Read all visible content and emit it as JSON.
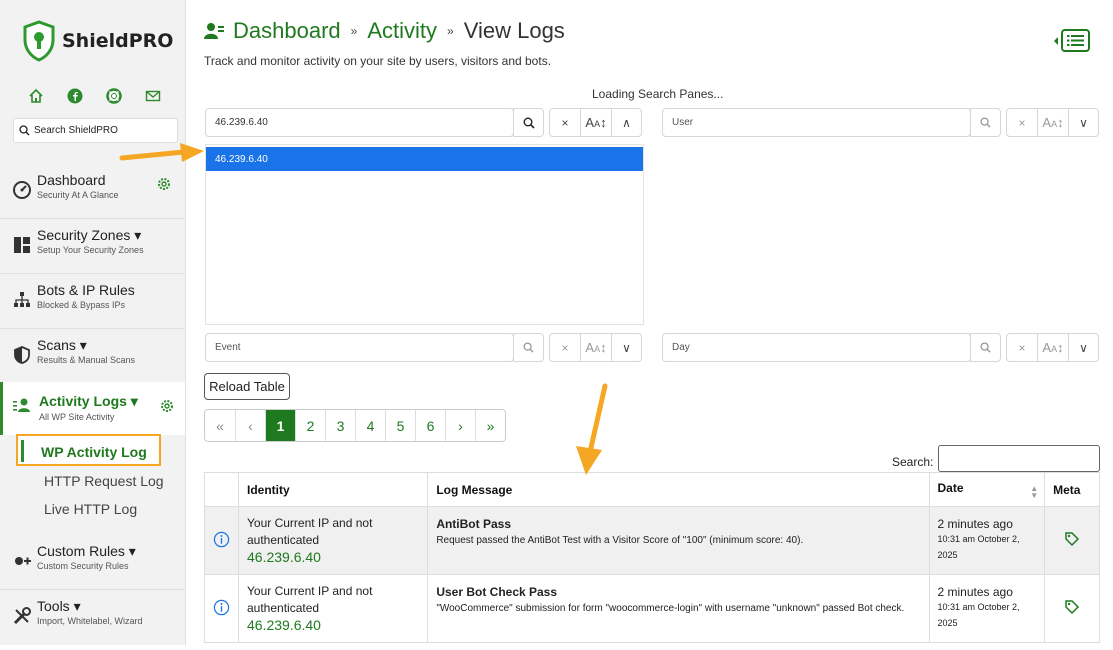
{
  "brand": {
    "name": "ShieldPRO"
  },
  "sidebar": {
    "search_label": "Search ShieldPRO",
    "items": [
      {
        "title": "Dashboard",
        "sub": "Security At A Glance"
      },
      {
        "title": "Security Zones ▾",
        "sub": "Setup Your Security Zones"
      },
      {
        "title": "Bots & IP Rules",
        "sub": "Blocked & Bypass IPs"
      },
      {
        "title": "Scans ▾",
        "sub": "Results & Manual Scans"
      },
      {
        "title": "Activity Logs ▾",
        "sub": "All WP Site Activity"
      },
      {
        "title": "Custom Rules ▾",
        "sub": "Custom Security Rules"
      },
      {
        "title": "Tools ▾",
        "sub": "Import, Whitelabel, Wizard"
      }
    ],
    "subitems": [
      "WP Activity Log",
      "HTTP Request Log",
      "Live HTTP Log"
    ]
  },
  "header": {
    "crumb1": "Dashboard",
    "crumb2": "Activity",
    "crumb3": "View Logs",
    "sep": "»",
    "tagline": "Track and monitor activity on your site by users, visitors and bots."
  },
  "panes": {
    "loading": "Loading Search Panes...",
    "ip_value": "46.239.6.40",
    "ip_selected": "46.239.6.40",
    "user_placeholder": "User",
    "event_placeholder": "Event",
    "day_placeholder": "Day"
  },
  "controls": {
    "reload": "Reload Table",
    "pages": [
      "«",
      "‹",
      "1",
      "2",
      "3",
      "4",
      "5",
      "6",
      "›",
      "»"
    ],
    "search_label": "Search:"
  },
  "table": {
    "headers": [
      "",
      "Identity",
      "Log Message",
      "Date",
      "Meta"
    ],
    "rows": [
      {
        "identity_line1": "Your Current IP and not",
        "identity_line2": "authenticated",
        "ip": "46.239.6.40",
        "title": "AntiBot Pass",
        "message": "Request passed the AntiBot Test with a Visitor Score of \"100\" (minimum score: 40).",
        "date_rel": "2 minutes ago",
        "date_abs1": "10:31 am October 2,",
        "date_abs2": "2025"
      },
      {
        "identity_line1": "Your Current IP and not",
        "identity_line2": "authenticated",
        "ip": "46.239.6.40",
        "title": "User Bot Check Pass",
        "message": "\"WooCommerce\" submission for form \"woocommerce-login\" with username \"unknown\" passed Bot check.",
        "date_rel": "2 minutes ago",
        "date_abs1": "10:31 am October 2,",
        "date_abs2": "2025"
      }
    ]
  },
  "colors": {
    "accent": "#1f7a1f",
    "selected": "#1a73e8",
    "highlight": "#f5a623"
  }
}
